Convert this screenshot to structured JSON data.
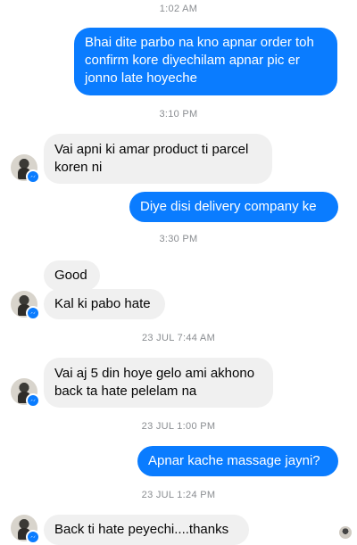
{
  "thread": {
    "timestamps": {
      "t1": "1:02 AM",
      "t2": "3:10 PM",
      "t3": "3:30 PM",
      "t4": "23 JUL 7:44 AM",
      "t5": "23 JUL 1:00 PM",
      "t6": "23 JUL 1:24 PM"
    },
    "messages": {
      "m1_line1": "Bhai dite parbo na kno apnar order toh",
      "m1_line2": "confirm kore diyechilam apnar pic er",
      "m1_line3": "jonno late hoyeche",
      "m2_line1": "Vai apni ki amar product ti parcel",
      "m2_line2": "koren ni",
      "m3": "Diye disi delivery company ke",
      "m4": "Good",
      "m5": "Kal ki pabo hate",
      "m6_line1": "Vai aj 5 din hoye gelo ami akhono",
      "m6_line2": "back ta hate pelelam na",
      "m7": "Apnar kache massage jayni?",
      "m8": "Back ti hate peyechi....thanks"
    }
  },
  "colors": {
    "outgoing_bubble": "#0a7cff",
    "incoming_bubble": "#f0f0f0",
    "timestamp": "#8a8d91"
  },
  "icons": {
    "avatar": "contact-avatar",
    "badge": "messenger-badge-icon"
  }
}
